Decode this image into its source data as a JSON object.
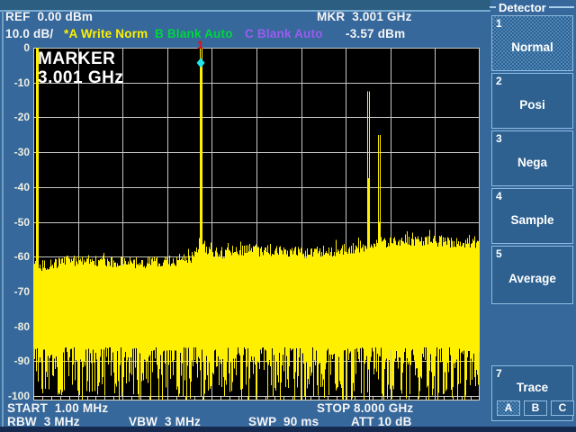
{
  "header": {
    "ref": "REF  0.00 dBm",
    "scale": "10.0 dB/",
    "trace_a_status": "*A Write Norm",
    "trace_b_status": "B Blank Auto",
    "trace_c_status": "C Blank Auto",
    "marker_freq_readout": "MKR  3.001 GHz",
    "marker_level_readout": "-3.57 dBm"
  },
  "plot": {
    "marker_label_line1": "MARKER",
    "marker_label_line2": "3.001 GHz",
    "marker_number": "1"
  },
  "footer": {
    "start": "START  1.00 MHz",
    "stop": "STOP 8.000 GHz",
    "rbw": "RBW  3 MHz",
    "vbw": "VBW  3 MHz",
    "swp": "SWP  90 ms",
    "att": "ATT 10 dB"
  },
  "sidebar": {
    "title": "Detector",
    "buttons": [
      {
        "number": "1",
        "label": "Normal",
        "selected": true
      },
      {
        "number": "2",
        "label": "Posi",
        "selected": false
      },
      {
        "number": "3",
        "label": "Nega",
        "selected": false
      },
      {
        "number": "4",
        "label": "Sample",
        "selected": false
      },
      {
        "number": "5",
        "label": "Average",
        "selected": false
      },
      {
        "number": "7",
        "label": "Trace",
        "selected": false
      }
    ],
    "trace_keys": [
      {
        "label": "A",
        "selected": true
      },
      {
        "label": "B",
        "selected": false
      },
      {
        "label": "C",
        "selected": false
      }
    ]
  },
  "colors": {
    "bg_blue": "#36689C",
    "strip_teal": "#2B5E81",
    "strip_navy": "#16294E",
    "panel_btn": "#2E6190",
    "sel_check": "#4D87BA",
    "trace_yellow": "#FFF000",
    "text_green": "#00D540",
    "text_violet": "#9C5BF0",
    "marker_red": "#E01010",
    "marker_cyan": "#20E6E8",
    "grid_gray": "#C6C6C6",
    "plot_black": "#000000"
  },
  "chart_data": {
    "type": "line",
    "subtype": "spectrum-analyzer-trace",
    "title": "",
    "xlabel": "Frequency",
    "ylabel": "Level (dBm)",
    "x_axis": {
      "start_ghz": 0.001,
      "stop_ghz": 8.0,
      "divisions": 10,
      "start_label": "START  1.00 MHz",
      "stop_label": "STOP 8.000 GHz"
    },
    "y_axis": {
      "ticks_dbm": [
        0,
        -10,
        -20,
        -30,
        -40,
        -50,
        -60,
        -70,
        -80,
        -90,
        -100
      ],
      "db_per_div": 10,
      "ref_dbm": 0
    },
    "grid": true,
    "marker": {
      "number": "1",
      "freq_ghz": 3.001,
      "level_dbm": -3.57
    },
    "peaks": [
      {
        "freq_ghz": 0.065,
        "level_dbm": 0.0
      },
      {
        "freq_ghz": 3.001,
        "level_dbm": -3.57
      },
      {
        "freq_ghz": 6.0,
        "level_dbm": -37.5
      },
      {
        "freq_ghz": 6.2,
        "level_dbm": -50.0
      }
    ],
    "noise_floor": {
      "left_top_dbm": -63.5,
      "right_top_dbm": -55.5,
      "dense_bottom_dbm": -86,
      "spike_bottom_dbm": -102
    }
  }
}
